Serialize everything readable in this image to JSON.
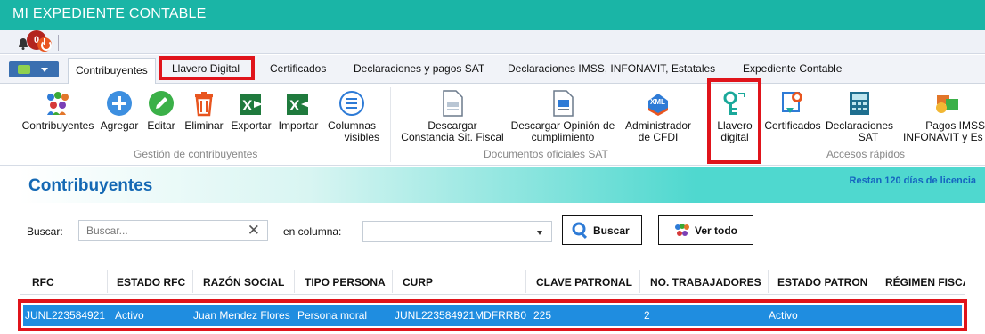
{
  "window": {
    "title": "MI EXPEDIENTE CONTABLE",
    "notifications": "0"
  },
  "tabs": [
    "Contribuyentes",
    "Llavero Digital",
    "Certificados",
    "Declaraciones y pagos SAT",
    "Declaraciones IMSS, INFONAVIT, Estatales",
    "Expediente Contable"
  ],
  "ribbon": {
    "contribuyentes": "Contribuyentes",
    "agregar": "Agregar",
    "editar": "Editar",
    "eliminar": "Eliminar",
    "exportar": "Exportar",
    "importar": "Importar",
    "columnas1": "Columnas",
    "columnas2": "visibles",
    "descargar1": "Descargar",
    "descargar2": "Constancia Sit. Fiscal",
    "opinion1": "Descargar Opinión de",
    "opinion2": "cumplimiento",
    "admin1": "Administrador",
    "admin2": "de CFDI",
    "llavero1": "Llavero",
    "llavero2": "digital",
    "certificados": "Certificados",
    "declaraciones1": "Declaraciones",
    "declaraciones2": "SAT",
    "pagos1": "Pagos IMSS",
    "pagos2": "INFONAVIT y Es",
    "group1": "Gestión de contribuyentes",
    "group2": "Documentos oficiales SAT",
    "group3": "Accesos rápidos",
    "xml_badge": "XML"
  },
  "main": {
    "title": "Contribuyentes",
    "license": "Restan 120 días de licencia",
    "search_label": "Buscar:",
    "search_placeholder": "Buscar...",
    "column_label": "en columna:",
    "buscar_button": "Buscar",
    "ver_todo_button": "Ver todo"
  },
  "table": {
    "headers": [
      "RFC",
      "ESTADO RFC",
      "RAZÓN SOCIAL",
      "TIPO PERSONA",
      "CURP",
      "CLAVE PATRONAL",
      "NO. TRABAJADORES",
      "ESTADO PATRON",
      "RÉGIMEN FISCA"
    ],
    "rows": [
      {
        "rfc": "JUNL223584921",
        "estado_rfc": "Activo",
        "razon_social": "Juan Mendez Flores",
        "tipo_persona": "Persona moral",
        "curp": "JUNL223584921MDFRRB0",
        "clave_patronal": "225",
        "no_trabajadores": "2",
        "estado_patron": "Activo",
        "regimen": ""
      }
    ]
  },
  "colors": {
    "titlebar": "#1ab5a6",
    "highlight": "#e0141b",
    "selected_row": "#1f8de0",
    "accent_title": "#1468b4"
  }
}
